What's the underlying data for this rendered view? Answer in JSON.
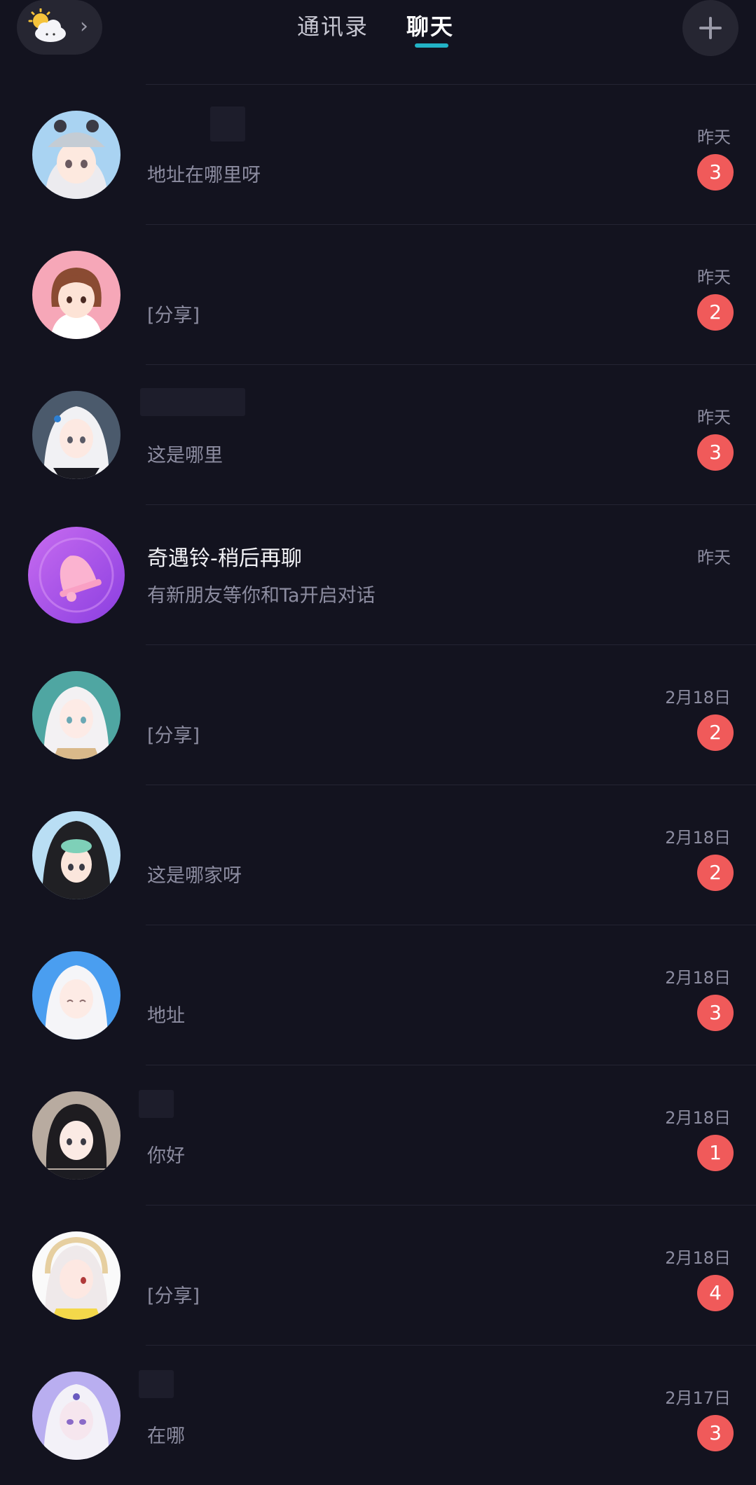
{
  "header": {
    "weather_icon": "partly-cloudy-icon",
    "chevron_glyph": "›",
    "tabs": [
      {
        "label": "通讯录",
        "active": false
      },
      {
        "label": "聊天",
        "active": true
      }
    ],
    "plus_icon": "plus-icon"
  },
  "colors": {
    "background": "#13131f",
    "accent": "#22b3c6",
    "badge": "#f05a5a",
    "pill": "#262632"
  },
  "chats": [
    {
      "name": "",
      "preview": "地址在哪里呀",
      "time": "昨天",
      "unread": "3",
      "avatar": "anime-girl-grey-bear-hat"
    },
    {
      "name": "",
      "preview": "[分享]",
      "time": "昨天",
      "unread": "2",
      "avatar": "anime-girl-brown-bob"
    },
    {
      "name": "",
      "preview": "这是哪里",
      "time": "昨天",
      "unread": "3",
      "avatar": "anime-girl-white-hair-bow"
    },
    {
      "name": "奇遇铃-稍后再聊",
      "preview": "有新朋友等你和Ta开启对话",
      "time": "昨天",
      "unread": "",
      "avatar": "bell-icon"
    },
    {
      "name": "",
      "preview": "[分享]",
      "time": "2月18日",
      "unread": "2",
      "avatar": "anime-girl-white-hair-teal"
    },
    {
      "name": "",
      "preview": "这是哪家呀",
      "time": "2月18日",
      "unread": "2",
      "avatar": "anime-girl-black-hood"
    },
    {
      "name": "",
      "preview": "地址",
      "time": "2月18日",
      "unread": "3",
      "avatar": "anime-girl-white-hair-blue"
    },
    {
      "name": "",
      "preview": "你好",
      "time": "2月18日",
      "unread": "1",
      "avatar": "anime-girl-black-bun"
    },
    {
      "name": "",
      "preview": "[分享]",
      "time": "2月18日",
      "unread": "4",
      "avatar": "anime-girl-headphones"
    },
    {
      "name": "",
      "preview": "在哪",
      "time": "2月17日",
      "unread": "3",
      "avatar": "anime-girl-purple"
    }
  ]
}
